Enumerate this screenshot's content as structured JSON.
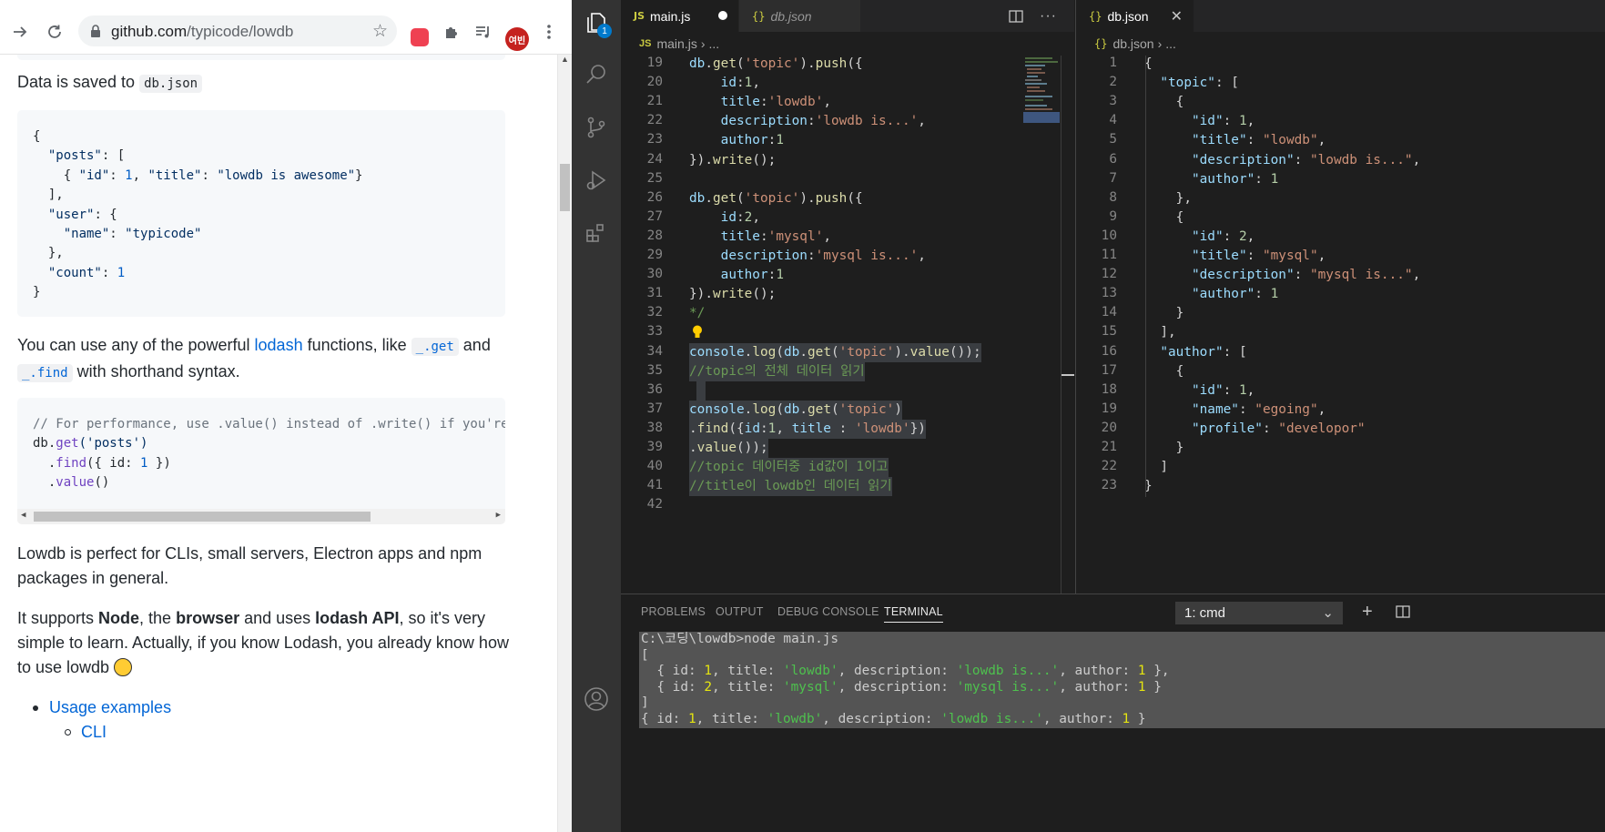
{
  "browser": {
    "url_host": "github.com",
    "url_path": "/typicode/lowdb",
    "avatar_text": "여빈",
    "content": {
      "saved_prefix": "Data is saved to ",
      "saved_code": "db.json",
      "json_block": [
        "{",
        "  \"posts\": [",
        "    { \"id\": 1, \"title\": \"lowdb is awesome\"}",
        "  ],",
        "  \"user\": {",
        "    \"name\": \"typicode\"",
        "  },",
        "  \"count\": 1",
        "}"
      ],
      "lodash_p": {
        "t1": "You can use any of the powerful ",
        "link": "lodash",
        "t2": " functions, like ",
        "code1": "_.get",
        "t3": " and",
        "code2": "_.find",
        "t4": " with shorthand syntax."
      },
      "perf_block": {
        "comment": "// For performance, use .value() instead of .write() if you're",
        "l2a": "db.",
        "l2fn": "get",
        "l2b": "('posts')",
        "l3a": "  .",
        "l3fn": "find",
        "l3b": "({ id: ",
        "l3num": "1",
        "l3c": " })",
        "l4a": "  .",
        "l4fn": "value",
        "l4b": "()"
      },
      "cli_p": "Lowdb is perfect for CLIs, small servers, Electron apps and npm packages in general.",
      "supports_p": {
        "t1": "It supports ",
        "b1": "Node",
        "t2": ", the ",
        "b2": "browser",
        "t3": " and uses ",
        "b3": "lodash API",
        "t4": ", so it's very simple to learn. Actually, if you know Lodash, you already know how to use lowdb "
      },
      "list": {
        "item1": "Usage examples",
        "item2": "CLI"
      }
    }
  },
  "vscode": {
    "badge_count": "1",
    "group1": {
      "tabs": [
        {
          "icon": "JS",
          "label": "main.js",
          "modified": true
        },
        {
          "icon": "{}",
          "label": "db.json",
          "preview": true
        }
      ],
      "breadcrumb": {
        "icon": "JS",
        "file": "main.js",
        "rest": "..."
      }
    },
    "group2": {
      "tabs": [
        {
          "icon": "{}",
          "label": "db.json"
        }
      ],
      "breadcrumb": {
        "icon": "{}",
        "file": "db.json",
        "rest": "..."
      }
    },
    "panel": {
      "tabs": [
        "PROBLEMS",
        "OUTPUT",
        "DEBUG CONSOLE",
        "TERMINAL"
      ],
      "active_tab": "TERMINAL",
      "terminal_select": "1: cmd",
      "terminal_lines": [
        "C:\\코딩\\lowdb>node main.js",
        "[",
        "  { id: 1, title: 'lowdb', description: 'lowdb is...', author: 1 },",
        "  { id: 2, title: 'mysql', description: 'mysql is...', author: 1 }",
        "]",
        "{ id: 1, title: 'lowdb', description: 'lowdb is...', author: 1 }"
      ]
    },
    "main_js_lines": [
      {
        "n": "19",
        "t": "db.get('topic').push({"
      },
      {
        "n": "20",
        "t": "    id:1,"
      },
      {
        "n": "21",
        "t": "    title:'lowdb',"
      },
      {
        "n": "22",
        "t": "    description:'lowdb is...',"
      },
      {
        "n": "23",
        "t": "    author:1"
      },
      {
        "n": "24",
        "t": "}).write();"
      },
      {
        "n": "25",
        "t": ""
      },
      {
        "n": "26",
        "t": "db.get('topic').push({"
      },
      {
        "n": "27",
        "t": "    id:2,"
      },
      {
        "n": "28",
        "t": "    title:'mysql',"
      },
      {
        "n": "29",
        "t": "    description:'mysql is...',"
      },
      {
        "n": "30",
        "t": "    author:1"
      },
      {
        "n": "31",
        "t": "}).write();"
      },
      {
        "n": "32",
        "t": "*/"
      },
      {
        "n": "33",
        "t": ""
      },
      {
        "n": "34",
        "t": "console.log(db.get('topic').value());"
      },
      {
        "n": "35",
        "t": "//topic의 전체 데이터 읽기"
      },
      {
        "n": "36",
        "t": ""
      },
      {
        "n": "37",
        "t": "console.log(db.get('topic')"
      },
      {
        "n": "38",
        "t": ".find({id:1, title : 'lowdb'})"
      },
      {
        "n": "39",
        "t": ".value());"
      },
      {
        "n": "40",
        "t": "//topic 데이터중 id값이 1이고"
      },
      {
        "n": "41",
        "t": "//title이 lowdb인 데이터 읽기"
      },
      {
        "n": "42",
        "t": ""
      }
    ],
    "db_json_lines": [
      {
        "n": "1",
        "t": "{"
      },
      {
        "n": "2",
        "t": "  \"topic\": ["
      },
      {
        "n": "3",
        "t": "    {"
      },
      {
        "n": "4",
        "t": "      \"id\": 1,"
      },
      {
        "n": "5",
        "t": "      \"title\": \"lowdb\","
      },
      {
        "n": "6",
        "t": "      \"description\": \"lowdb is...\","
      },
      {
        "n": "7",
        "t": "      \"author\": 1"
      },
      {
        "n": "8",
        "t": "    },"
      },
      {
        "n": "9",
        "t": "    {"
      },
      {
        "n": "10",
        "t": "      \"id\": 2,"
      },
      {
        "n": "11",
        "t": "      \"title\": \"mysql\","
      },
      {
        "n": "12",
        "t": "      \"description\": \"mysql is...\","
      },
      {
        "n": "13",
        "t": "      \"author\": 1"
      },
      {
        "n": "14",
        "t": "    }"
      },
      {
        "n": "15",
        "t": "  ],"
      },
      {
        "n": "16",
        "t": "  \"author\": ["
      },
      {
        "n": "17",
        "t": "    {"
      },
      {
        "n": "18",
        "t": "      \"id\": 1,"
      },
      {
        "n": "19",
        "t": "      \"name\": \"egoing\","
      },
      {
        "n": "20",
        "t": "      \"profile\": \"developor\""
      },
      {
        "n": "21",
        "t": "    }"
      },
      {
        "n": "22",
        "t": "  ]"
      },
      {
        "n": "23",
        "t": "}"
      }
    ]
  },
  "colors": {
    "link": "#0366d6",
    "vscode_bg": "#1e1e1e",
    "activity_bg": "#333333",
    "accent": "#007acc"
  }
}
